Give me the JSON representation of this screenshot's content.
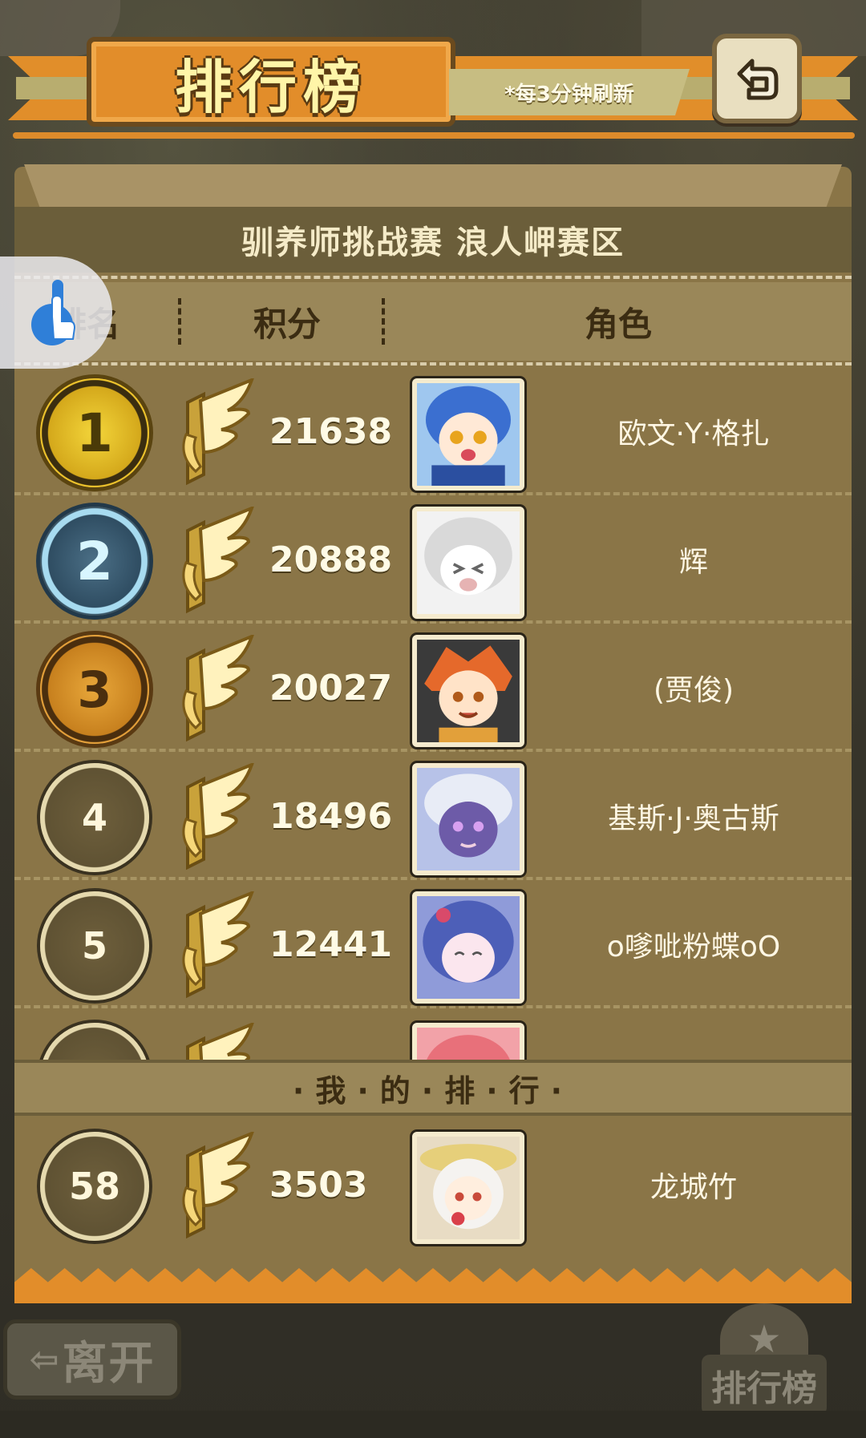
{
  "header": {
    "title": "排行榜",
    "refresh_note": "*每3分钟刷新",
    "back_icon": "back-arrow-icon"
  },
  "panel": {
    "subtitle": "驯养师挑战赛 浪人岬赛区",
    "columns": {
      "rank": "排名",
      "score": "积分",
      "character": "角色"
    }
  },
  "rows": [
    {
      "rank": "1",
      "score": "21638",
      "name": "欧文·Y·格扎",
      "badge": "gold",
      "avatar_color": "#3b6fd0"
    },
    {
      "rank": "2",
      "score": "20888",
      "name": "辉",
      "badge": "silver",
      "avatar_color": "#e6e6e6"
    },
    {
      "rank": "3",
      "score": "20027",
      "name": "(贾俊)",
      "badge": "bronze",
      "avatar_color": "#e5692b"
    },
    {
      "rank": "4",
      "score": "18496",
      "name": "基斯·J·奥古斯",
      "badge": "plain",
      "avatar_color": "#6d5ba8"
    },
    {
      "rank": "5",
      "score": "12441",
      "name": "o嗲呲粉蝶oO",
      "badge": "plain",
      "avatar_color": "#4d5fb8"
    }
  ],
  "my_rank": {
    "label": "·我·的·排·行·",
    "rank": "58",
    "score": "3503",
    "name": "龙城竹",
    "avatar_color": "#f0e6d0"
  },
  "footer": {
    "leave_label": "离开",
    "leave_icon": "left-arrow-icon",
    "leaderboard_label": "排行榜"
  },
  "colors": {
    "accent_orange": "#e28d2a",
    "panel_brown": "#8a7547",
    "title_yellow": "#fff5a8"
  }
}
